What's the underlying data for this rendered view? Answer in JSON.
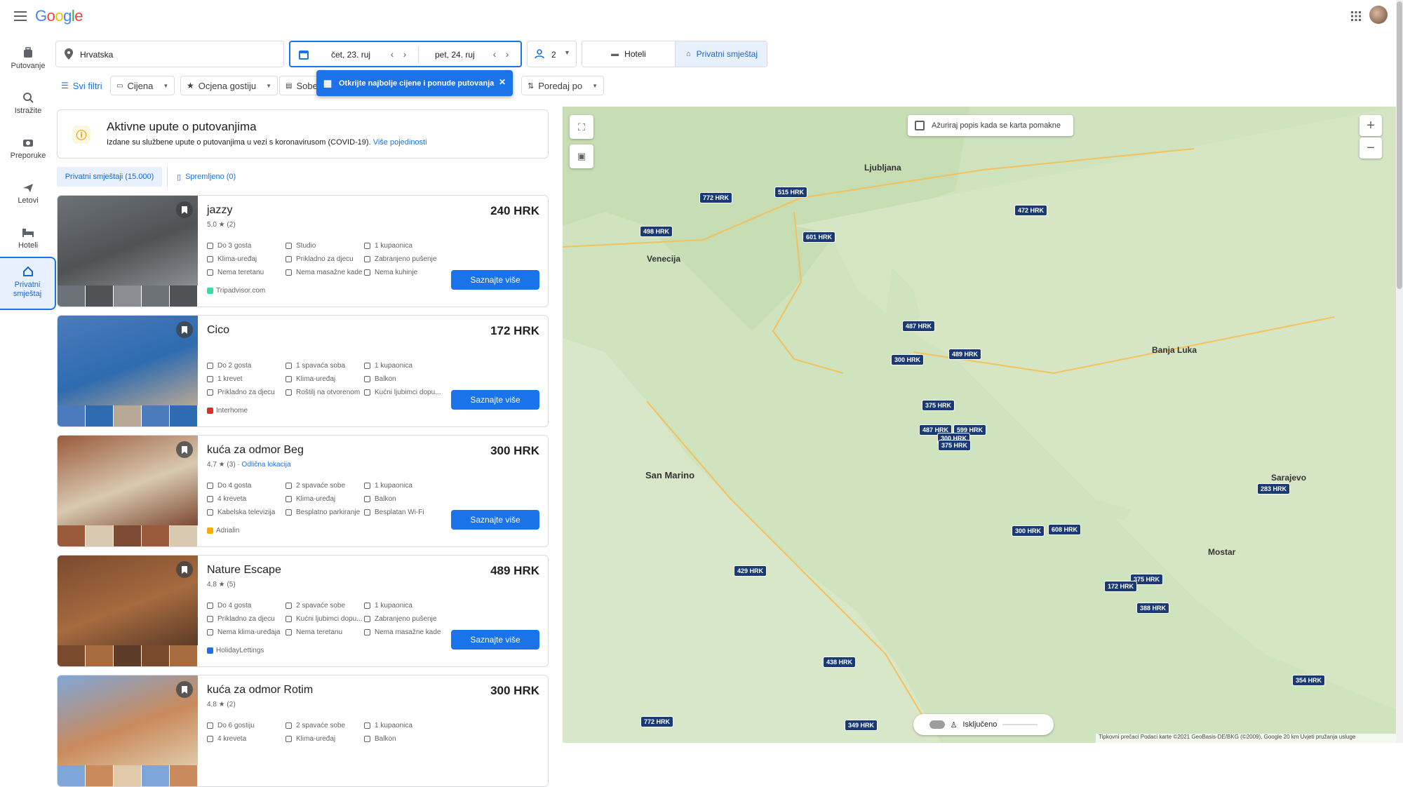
{
  "header": {
    "logo": "Google"
  },
  "nav": [
    {
      "label": "Putovanje",
      "icon": "suitcase-icon"
    },
    {
      "label": "Istražite",
      "icon": "explore-icon"
    },
    {
      "label": "Preporuke",
      "icon": "camera-icon"
    },
    {
      "label": "Letovi",
      "icon": "plane-icon"
    },
    {
      "label": "Hoteli",
      "icon": "bed-icon"
    },
    {
      "label": "Privatni smještaj",
      "icon": "house-icon"
    }
  ],
  "search": {
    "location": "Hrvatska",
    "checkin": "čet, 23. ruj",
    "checkout": "pet, 24. ruj",
    "guests": "2",
    "tab_hotels": "Hoteli",
    "tab_private": "Privatni smještaj"
  },
  "filters": {
    "all": "Svi filtri",
    "price": "Cijena",
    "rating": "Ocjena gostiju",
    "rooms": "Sobe",
    "sort": "Poredaj po"
  },
  "tooltip": {
    "text": "Otkrijte najbolje cijene i ponude putovanja"
  },
  "advisory": {
    "title": "Aktivne upute o putovanjima",
    "text": "Izdane su službene upute o putovanjima u vezi s koronavirusom (COVID-19).",
    "link": "Više pojedinosti"
  },
  "results_tabs": {
    "count": "Privatni smještaji (15.000)",
    "saved": "Spremljeno (0)"
  },
  "listings": [
    {
      "name": "jazzy",
      "rating": "5,0 ★ (2)",
      "location_badge": "",
      "price": "240 HRK",
      "amenities": [
        "Do 3 gosta",
        "Studio",
        "1 kupaonica",
        "Klima-uređaj",
        "Prikladno za djecu",
        "Zabranjeno pušenje",
        "Nema teretanu",
        "Nema masažne kade",
        "Nema kuhinje"
      ],
      "source": "Tripadvisor.com",
      "source_color": "#34e0a1",
      "cta": "Saznajte više",
      "photo_colors": [
        "#6d7278",
        "#4f5356",
        "#8a8d91"
      ]
    },
    {
      "name": "Cico",
      "rating": "",
      "location_badge": "",
      "price": "172 HRK",
      "amenities": [
        "Do 2 gosta",
        "1 spavaća soba",
        "1 kupaonica",
        "1 krevet",
        "Klima-uređaj",
        "Balkon",
        "Prikladno za djecu",
        "Roštilj na otvorenom",
        "Kućni ljubimci dopu..."
      ],
      "source": "Interhome",
      "source_color": "#d93025",
      "cta": "Saznajte više",
      "photo_colors": [
        "#4b7bbd",
        "#2f6bb0",
        "#b7a795"
      ]
    },
    {
      "name": "kuća za odmor Beg",
      "rating": "4,7 ★ (3)",
      "location_badge": "Odlična lokacija",
      "price": "300 HRK",
      "amenities": [
        "Do 4 gosta",
        "2 spavaće sobe",
        "1 kupaonica",
        "4 kreveta",
        "Klima-uređaj",
        "Balkon",
        "Kabelska televizija",
        "Besplatno parkiranje",
        "Besplatan Wi-Fi"
      ],
      "source": "Adrialin",
      "source_color": "#f9ab00",
      "cta": "Saznajte više",
      "photo_colors": [
        "#9a5a3c",
        "#d9c9b0",
        "#7d4a33"
      ]
    },
    {
      "name": "Nature Escape",
      "rating": "4,8 ★ (5)",
      "location_badge": "",
      "price": "489 HRK",
      "amenities": [
        "Do 4 gosta",
        "2 spavaće sobe",
        "1 kupaonica",
        "Prikladno za djecu",
        "Kućni ljubimci dopu...",
        "Zabranjeno pušenje",
        "Nema klima-uređaja",
        "Nema teretanu",
        "Nema masažne kade"
      ],
      "source": "HolidayLettings",
      "source_color": "#1a73e8",
      "cta": "Saznajte više",
      "photo_colors": [
        "#7a4a2e",
        "#a66b3f",
        "#5c3b28"
      ]
    },
    {
      "name": "kuća za odmor Rotim",
      "rating": "4,8 ★ (2)",
      "location_badge": "",
      "price": "300 HRK",
      "amenities": [
        "Do 6 gostiju",
        "2 spavaće sobe",
        "1 kupaonica",
        "4 kreveta",
        "Klima-uređaj",
        "Balkon"
      ],
      "source": "",
      "source_color": "#ffffff",
      "cta": "",
      "photo_colors": [
        "#7fa6d8",
        "#c98a5c",
        "#e0c9a8"
      ]
    }
  ],
  "map": {
    "checkbox_label": "Ažuriraj popis kada se karta pomakne",
    "pegman": "Isključeno",
    "footer": "Tipkovni prečaci   Podaci karte ©2021 GeoBasis-DE/BKG (©2009), Google   20 km   Uvjeti pružanja usluge",
    "cities": [
      "Ljubljana",
      "Venecija",
      "San Marino",
      "Sarajevo",
      "Mostar",
      "Banja Luka"
    ],
    "prices": [
      "772 HRK",
      "515 HRK",
      "472 HRK",
      "498 HRK",
      "601 HRK",
      "487 HRK",
      "489 HRK",
      "300 HRK",
      "375 HRK",
      "487 HRK",
      "599 HRK",
      "300 HRK",
      "375 HRK",
      "283 HRK",
      "300 HRK",
      "608 HRK",
      "429 HRK",
      "375 HRK",
      "172 HRK",
      "388 HRK",
      "438 HRK",
      "354 HRK",
      "772 HRK",
      "349 HRK"
    ]
  }
}
